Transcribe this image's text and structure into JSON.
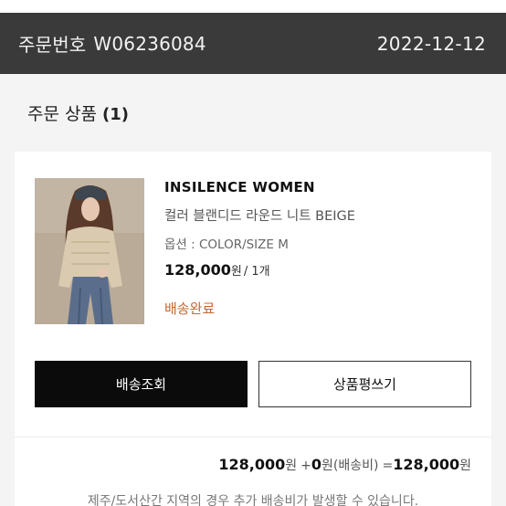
{
  "header": {
    "order_label": "주문번호",
    "order_number": "W06236084",
    "date": "2022-12-12"
  },
  "section": {
    "title": "주문 상품",
    "count": "(1)"
  },
  "product": {
    "brand": "INSILENCE WOMEN",
    "name": "컬러 블랜디드 라운드 니트 BEIGE",
    "option": "옵션 : COLOR/SIZE M",
    "price": "128,000",
    "price_unit": "원",
    "quantity": "/ 1개",
    "status": "배송완료"
  },
  "buttons": {
    "track": "배송조회",
    "review": "상품평쓰기"
  },
  "summary": {
    "product_total": "128,000",
    "product_total_unit": "원",
    "plus": "+",
    "shipping": "0",
    "shipping_unit": "원(배송비)",
    "equals": "=",
    "grand_total": "128,000",
    "grand_total_unit": "원"
  },
  "notice": "제주/도서산간 지역의 경우 추가 배송비가 발생할 수 있습니다.",
  "colors": {
    "header_bg": "#3a3a3a",
    "status": "#c4682e",
    "primary_button": "#0b0b0b"
  },
  "icons": {
    "product_image": "product-photo"
  }
}
